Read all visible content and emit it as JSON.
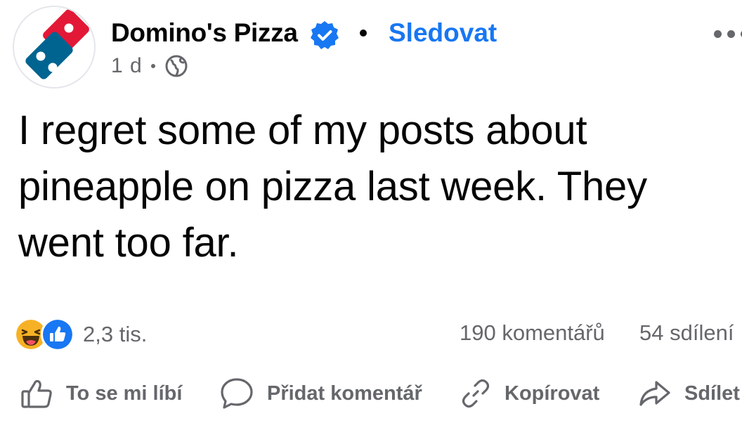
{
  "post": {
    "page_name": "Domino's Pizza",
    "follow_label": "Sledovat",
    "time": "1 d",
    "text": "I regret some of my posts about pineapple on pizza last week. They went too far."
  },
  "stats": {
    "reaction_count": "2,3 tis.",
    "comments": "190 komentářů",
    "shares": "54 sdílení"
  },
  "actions": {
    "like": "To se mi líbí",
    "comment": "Přidat komentář",
    "copy": "Kopírovat",
    "share": "Sdílet"
  },
  "icons": {
    "avatar": "dominos-logo",
    "verified": "verified-badge-icon",
    "privacy": "globe-icon",
    "more": "more-options-icon",
    "reaction_1": "haha-reaction-icon",
    "reaction_2": "like-reaction-icon"
  },
  "colors": {
    "accent": "#1877f2",
    "secondary_text": "#65676b",
    "dominos_red": "#e31837",
    "dominos_blue": "#006491"
  }
}
